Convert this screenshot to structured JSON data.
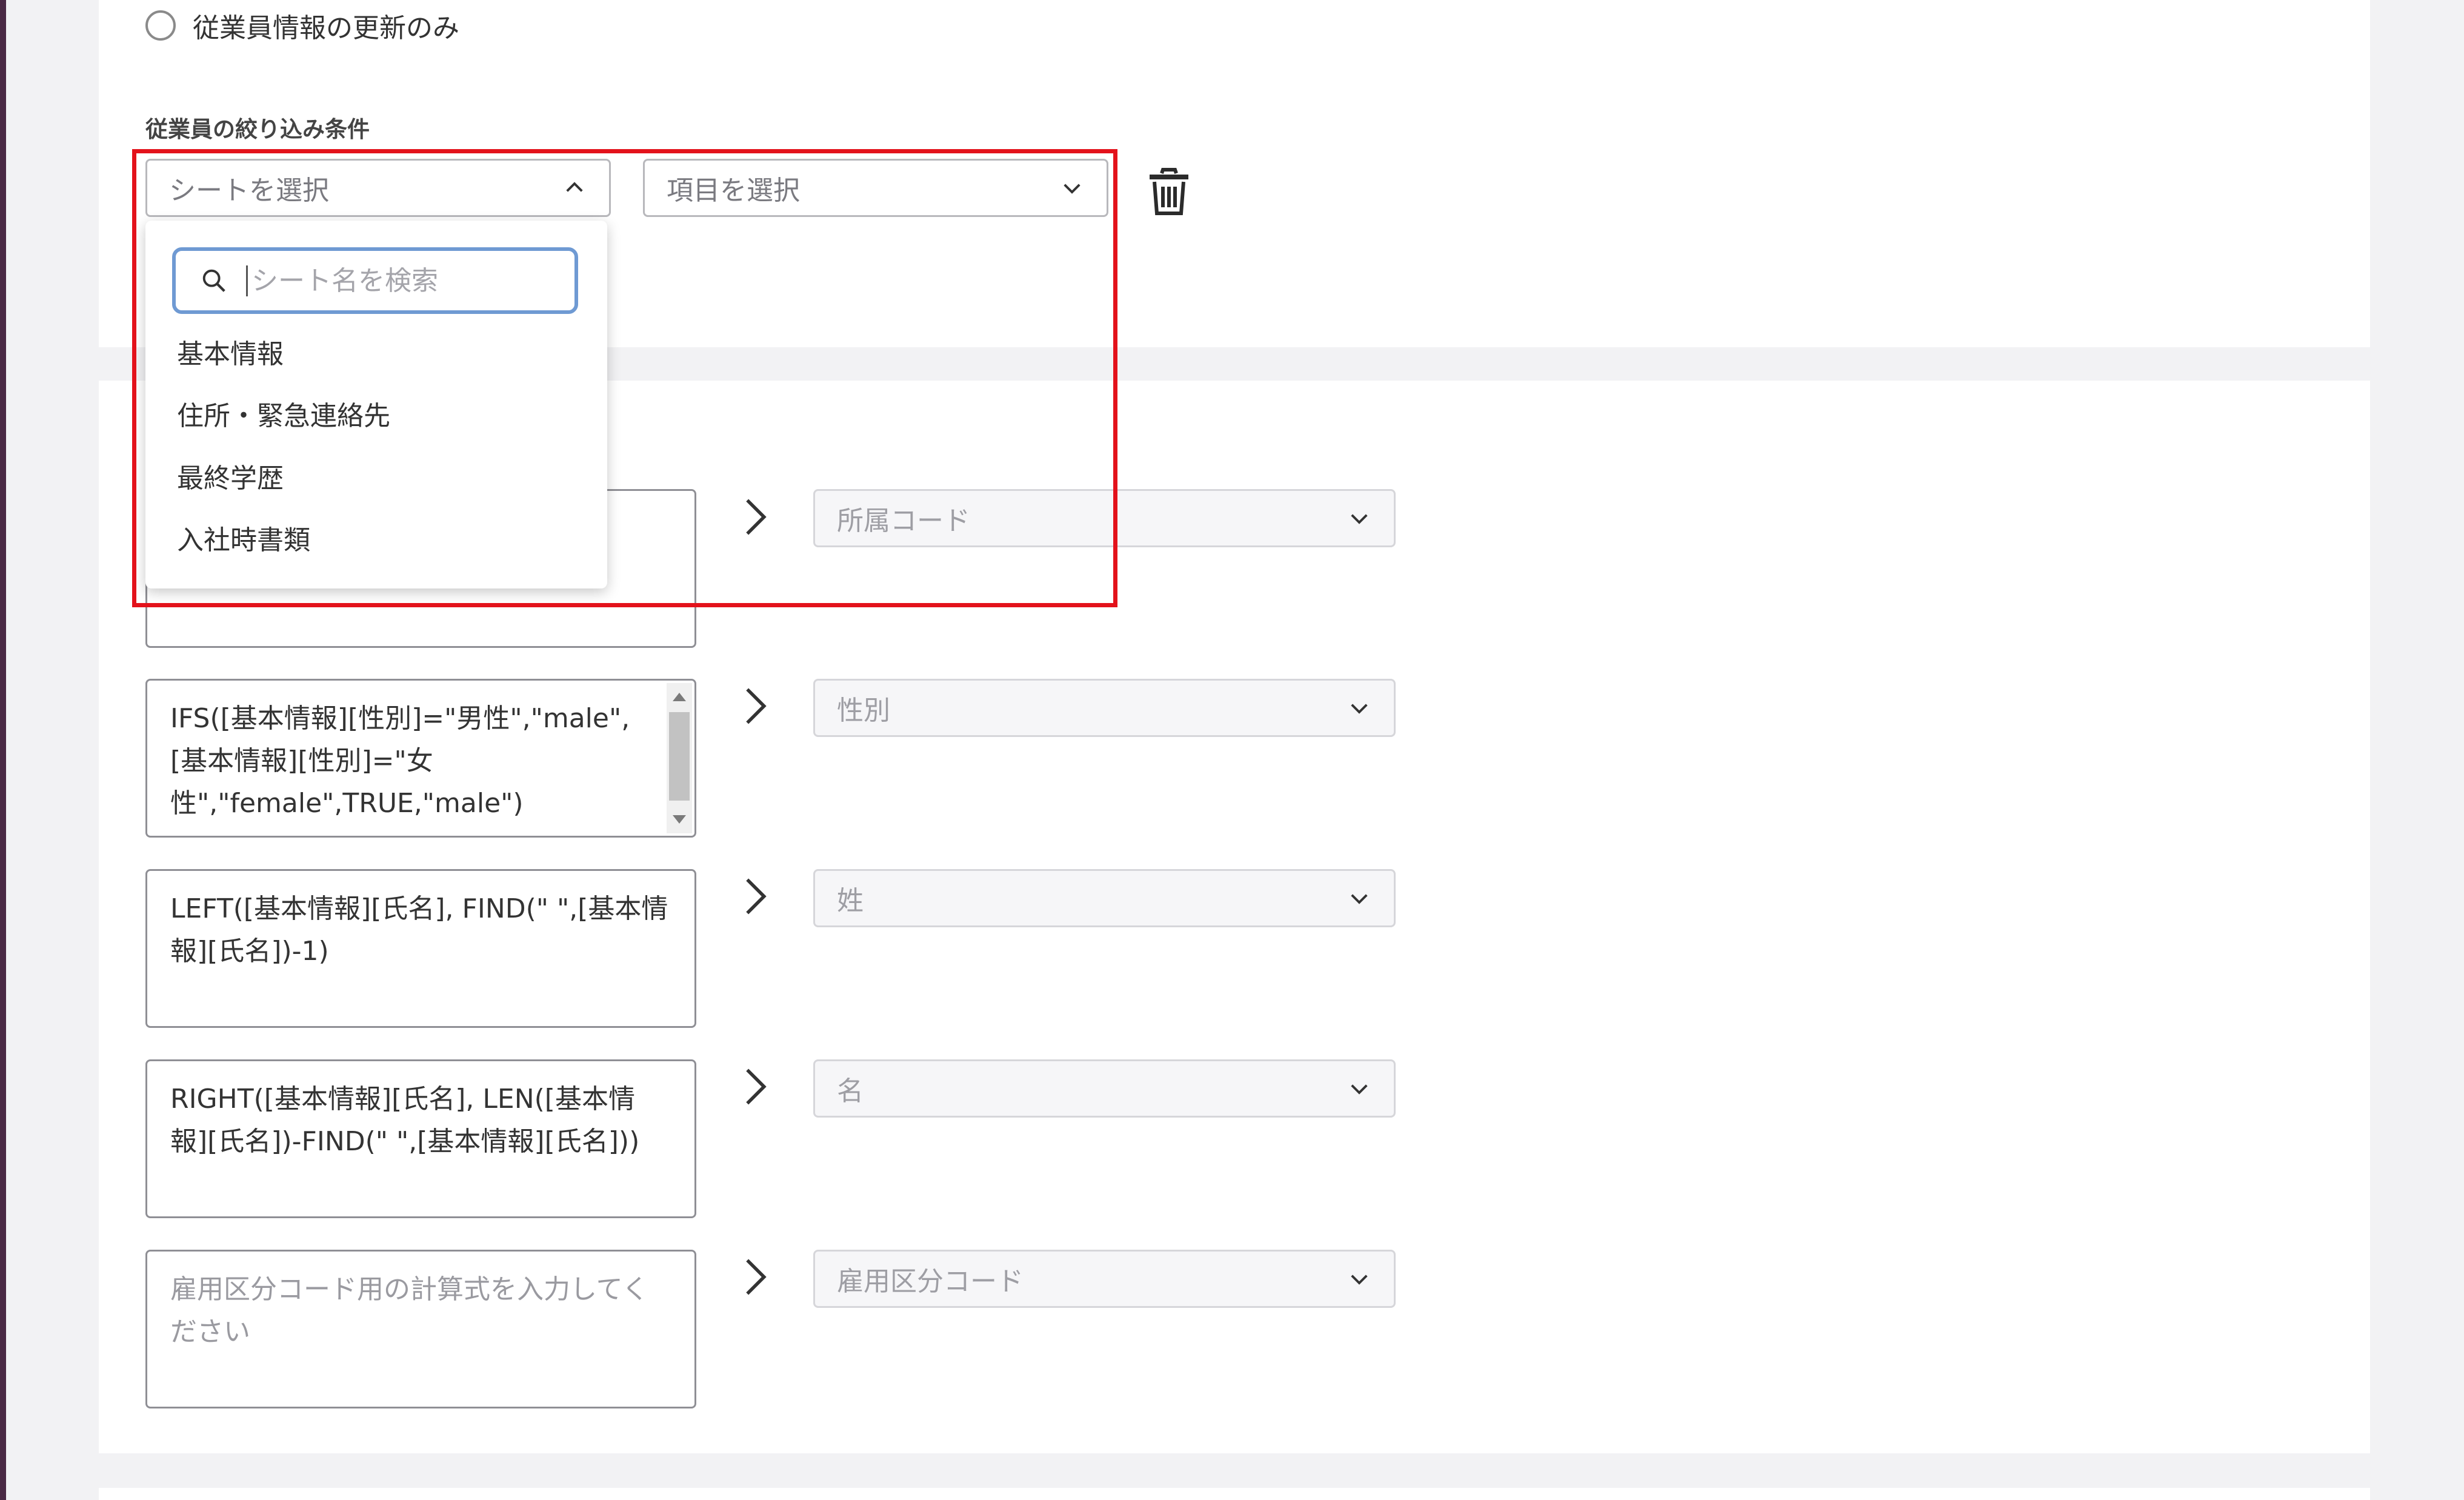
{
  "update_option": {
    "label": "従業員情報の更新のみ",
    "selected": false
  },
  "filter": {
    "title": "従業員の絞り込み条件",
    "sheet_select": {
      "placeholder": "シートを選択",
      "expanded": true
    },
    "field_select": {
      "placeholder": "項目を選択"
    },
    "dropdown": {
      "search_placeholder": "シート名を検索",
      "items": [
        "基本情報",
        "住所・緊急連絡先",
        "最終学歴",
        "入社時書類"
      ]
    }
  },
  "mappings": [
    {
      "formula": "",
      "target": "所属コード"
    },
    {
      "formula": "IFS([基本情報][性別]=\"男性\",\"male\",[基本情報][性別]=\"女性\",\"female\",TRUE,\"male\")",
      "target": "性別"
    },
    {
      "formula": "LEFT([基本情報][氏名], FIND(\" \",[基本情報][氏名])-1)",
      "target": "姓"
    },
    {
      "formula": "RIGHT([基本情報][氏名], LEN([基本情報][氏名])-FIND(\" \",[基本情報][氏名]))",
      "target": "名"
    },
    {
      "formula_placeholder": "雇用区分コード用の計算式を入力してください",
      "target": "雇用区分コード"
    }
  ],
  "colors": {
    "highlight": "#e3121b",
    "focus_border": "#6f9ad3"
  }
}
